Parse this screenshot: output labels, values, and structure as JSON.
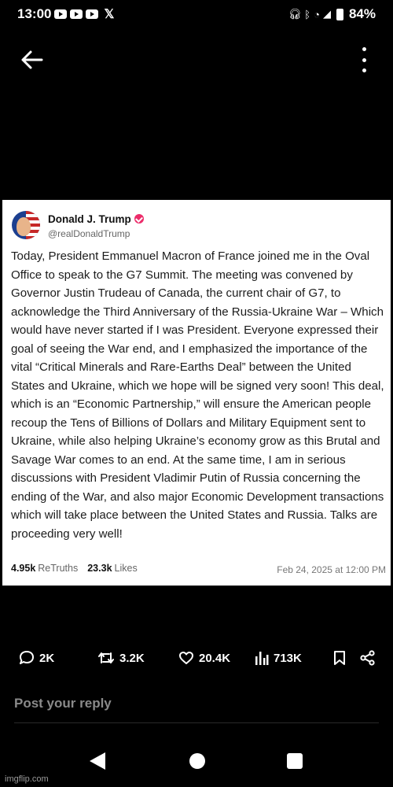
{
  "status_bar": {
    "time": "13:00",
    "battery": "84%",
    "icons": [
      "youtube-icon",
      "youtube-icon",
      "youtube-icon",
      "x-icon",
      "headphones-icon",
      "bluetooth-icon",
      "wifi-icon",
      "signal-icon",
      "battery-icon"
    ]
  },
  "top_bar": {
    "back_icon": "arrow-left-icon",
    "more_icon": "more-vertical-icon"
  },
  "post": {
    "author": "Donald J. Trump",
    "handle": "@realDonaldTrump",
    "verified_color": "#ec2c6a",
    "text": "Today, President Emmanuel Macron of France joined me in the Oval Office to speak to the G7 Summit. The meeting was convened by Governor Justin Trudeau of Canada, the current chair of G7, to acknowledge the Third Anniversary of the Russia-Ukraine War – Which would have never started if I was President. Everyone expressed their goal of seeing the War end, and I emphasized the importance of the vital “Critical Minerals and Rare-Earths Deal” between the United States and Ukraine, which we hope will be signed very soon! This deal, which is an “Economic Partnership,” will ensure the American people recoup the Tens of Billions of Dollars and Military Equipment sent to Ukraine, while also helping Ukraine’s economy grow as this Brutal and Savage War comes to an end. At the same time, I am in serious discussions with President Vladimir Putin of Russia concerning the ending of the War, and also major Economic Development transactions which will take place between the United States and Russia. Talks are proceeding very well!",
    "retruths_count": "4.95k",
    "retruths_label": "ReTruths",
    "likes_count": "23.3k",
    "likes_label": "Likes",
    "date": "Feb 24, 2025 at 12:00 PM"
  },
  "actions": {
    "replies": "2K",
    "reposts": "3.2K",
    "likes": "20.4K",
    "views": "713K"
  },
  "reply": {
    "placeholder": "Post your reply"
  },
  "watermark": "imgflip.com"
}
